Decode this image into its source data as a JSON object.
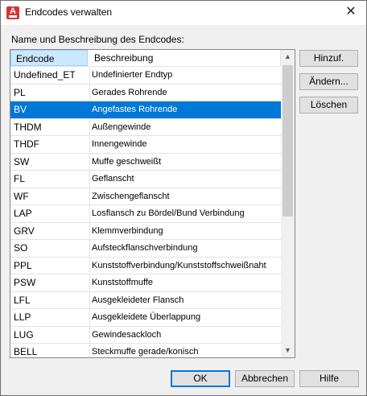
{
  "window": {
    "title": "Endcodes verwalten",
    "close_symbol": "✕"
  },
  "prompt_label": "Name und Beschreibung des Endcodes:",
  "columns": {
    "code": "Endcode",
    "description": "Beschreibung"
  },
  "rows": [
    {
      "code": "Undefined_ET",
      "description": "Undefinierter Endtyp"
    },
    {
      "code": "PL",
      "description": "Gerades Rohrende"
    },
    {
      "code": "BV",
      "description": "Angefastes Rohrende",
      "selected": true
    },
    {
      "code": "THDM",
      "description": "Außengewinde"
    },
    {
      "code": "THDF",
      "description": "Innengewinde"
    },
    {
      "code": "SW",
      "description": "Muffe geschweißt"
    },
    {
      "code": "FL",
      "description": "Geflanscht"
    },
    {
      "code": "WF",
      "description": "Zwischengeflanscht"
    },
    {
      "code": "LAP",
      "description": "Losflansch zu Bördel/Bund Verbindung"
    },
    {
      "code": "GRV",
      "description": "Klemmverbindung"
    },
    {
      "code": "SO",
      "description": "Aufsteckflanschverbindung"
    },
    {
      "code": "PPL",
      "description": "Kunststoffverbindung/Kunststoffschweißnaht"
    },
    {
      "code": "PSW",
      "description": "Kunststoffmuffe"
    },
    {
      "code": "LFL",
      "description": "Ausgekleideter Flansch"
    },
    {
      "code": "LLP",
      "description": "Ausgekleidete Überlappung"
    },
    {
      "code": "LUG",
      "description": "Gewindesackloch"
    },
    {
      "code": "BELL",
      "description": "Steckmuffe gerade/konisch"
    }
  ],
  "side_buttons": {
    "add": "Hinzuf.",
    "edit": "Ändern...",
    "delete": "Löschen"
  },
  "footer_buttons": {
    "ok": "OK",
    "cancel": "Abbrechen",
    "help": "Hilfe"
  },
  "colors": {
    "selection": "#0078d7",
    "app_icon": "#d7322e"
  }
}
